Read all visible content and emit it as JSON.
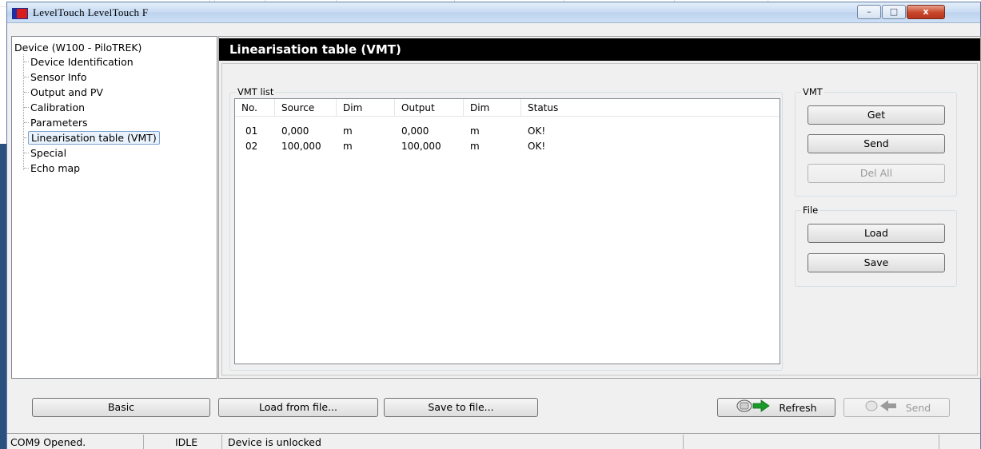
{
  "window": {
    "title": "LevelTouch   LevelTouch F",
    "minimize": "–",
    "maximize": "□",
    "close": "x"
  },
  "tree": {
    "root": "Device (W100 - PiloTREK)",
    "items": [
      {
        "label": "Device Identification"
      },
      {
        "label": "Sensor Info"
      },
      {
        "label": "Output and PV"
      },
      {
        "label": "Calibration"
      },
      {
        "label": "Parameters"
      },
      {
        "label": "Linearisation table (VMT)",
        "selected": true
      },
      {
        "label": "Special"
      },
      {
        "label": "Echo map"
      }
    ]
  },
  "content": {
    "header": "Linearisation table (VMT)",
    "vmt_list": {
      "title": "VMT list",
      "columns": [
        "No.",
        "Source",
        "Dim",
        "Output",
        "Dim",
        "Status"
      ],
      "rows": [
        [
          "01",
          "0,000",
          "m",
          "0,000",
          "m",
          "OK!"
        ],
        [
          "02",
          "100,000",
          "m",
          "100,000",
          "m",
          "OK!"
        ]
      ]
    },
    "vmt_group": {
      "title": "VMT",
      "get": "Get",
      "send": "Send",
      "del_all": "Del All"
    },
    "file_group": {
      "title": "File",
      "load": "Load",
      "save": "Save"
    }
  },
  "bottom": {
    "basic": "Basic",
    "load_from_file": "Load from file...",
    "save_to_file": "Save to file...",
    "refresh": "Refresh",
    "send": "Send"
  },
  "status": {
    "port": "COM9 Opened.",
    "state": "IDLE",
    "lock": "Device is unlocked"
  },
  "colors": {
    "header_bg": "#000000",
    "header_text": "#ffffff",
    "refresh_arrow": "#1a9a2a",
    "send_arrow_disabled": "#9a9a9a"
  }
}
